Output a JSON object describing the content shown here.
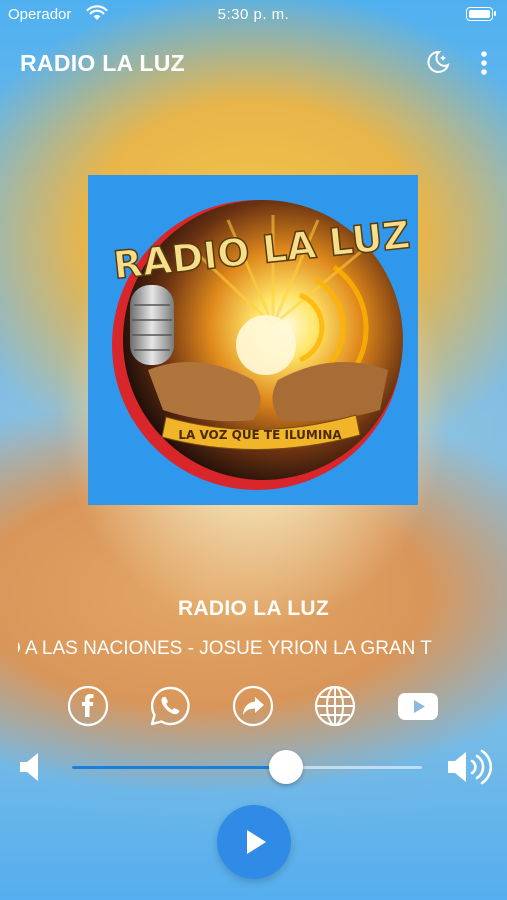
{
  "status_bar": {
    "carrier": "Operador",
    "time": "5:30 p. m."
  },
  "app_bar": {
    "title": "RADIO LA LUZ",
    "icons": [
      "night-mode-icon",
      "more-vert-icon"
    ]
  },
  "artwork": {
    "logo_text": "RADIO LA LUZ",
    "logo_slogan": "LA VOZ QUE TE ILUMINA",
    "background_color": "#2f98ec"
  },
  "now_playing": {
    "station_name": "RADIO LA LUZ",
    "track": "O A LAS NACIONES - JOSUE YRION LA GRAN T"
  },
  "social": [
    {
      "name": "facebook",
      "icon": "facebook-icon"
    },
    {
      "name": "whatsapp",
      "icon": "whatsapp-icon"
    },
    {
      "name": "share",
      "icon": "share-icon"
    },
    {
      "name": "website",
      "icon": "globe-icon"
    },
    {
      "name": "youtube",
      "icon": "youtube-icon"
    }
  ],
  "volume": {
    "level": 0.61,
    "low_icon": "volume-low-icon",
    "high_icon": "volume-high-icon"
  },
  "player": {
    "state": "paused",
    "button_icon": "play-icon",
    "accent_color": "#2f8be6"
  }
}
